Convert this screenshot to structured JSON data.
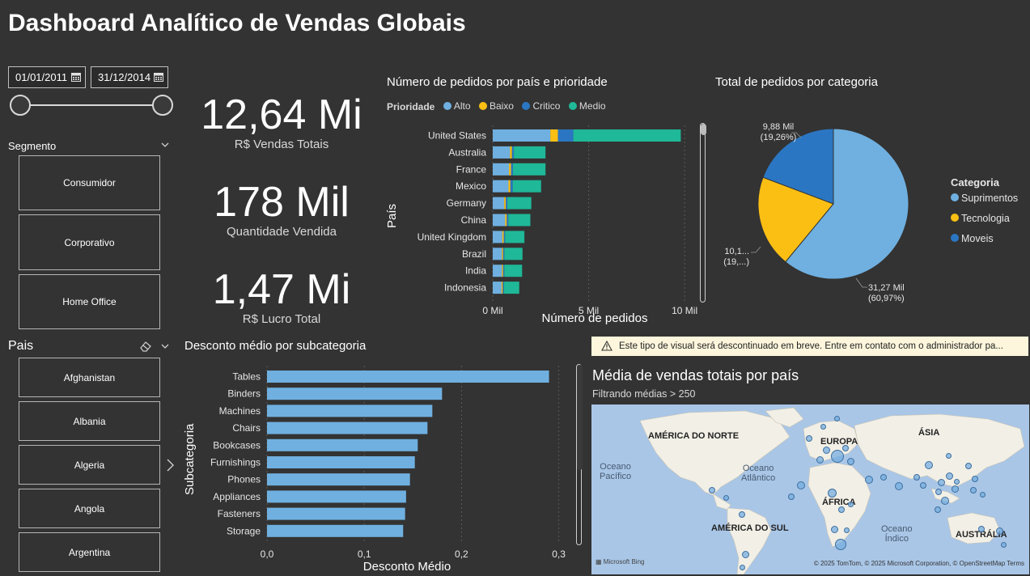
{
  "title": "Dashboard Analítico de Vendas Globais",
  "filters": {
    "date_start": "01/01/2011",
    "date_end": "31/12/2014",
    "segment_label": "Segmento",
    "segments": [
      "Consumidor",
      "Corporativo",
      "Home Office"
    ],
    "country_label": "Pais",
    "countries": [
      "Afghanistan",
      "Albania",
      "Algeria",
      "Angola",
      "Argentina"
    ]
  },
  "kpis": [
    {
      "value": "12,64 Mi",
      "label": "R$ Vendas Totais"
    },
    {
      "value": "178 Mil",
      "label": "Quantidade Vendida"
    },
    {
      "value": "1,47 Mi",
      "label": "R$ Lucro Total"
    }
  ],
  "colors": {
    "alto": "#6fb0e0",
    "baixo": "#fbbf14",
    "critico": "#2b76c2",
    "medio": "#1fb898",
    "bar": "#6fb0e0",
    "background": "#333333"
  },
  "orders_chart": {
    "title": "Número de pedidos por país e prioridade",
    "legend_title": "Prioridade",
    "legend": [
      "Alto",
      "Baixo",
      "Critico",
      "Medio"
    ],
    "ylabel": "País",
    "xlabel": "Número de pedidos",
    "xticks": [
      "0 Mil",
      "5 Mil",
      "10 Mil"
    ]
  },
  "category_chart": {
    "title": "Total de pedidos por categoria",
    "legend_title": "Categoria",
    "legend": [
      "Suprimentos",
      "Tecnologia",
      "Moveis"
    ],
    "labels": [
      {
        "line1": "31,27 Mil",
        "line2": "(60,97%)"
      },
      {
        "line1": "10,1...",
        "line2": "(19,...)"
      },
      {
        "line1": "9,88 Mil",
        "line2": "(19,26%)"
      }
    ]
  },
  "discount_chart": {
    "title": "Desconto médio por subcategoria",
    "ylabel": "Subcategoria",
    "xlabel": "Desconto Médio",
    "xticks": [
      "0,0",
      "0,1",
      "0,2",
      "0,3"
    ]
  },
  "map_visual": {
    "warning": "Este tipo de visual será descontinuado em breve. Entre em contato com o administrador pa...",
    "title": "Média de vendas totais por país",
    "subtitle": "Filtrando médias > 250",
    "labels": {
      "north_america": "AMÉRICA DO NORTE",
      "europe": "EUROPA",
      "asia": "ÁSIA",
      "africa": "ÁFRICA",
      "south_america": "AMÉRICA DO SUL",
      "australia": "AUSTRÁLIA",
      "pacific_1": "Oceano",
      "pacific_2": "Pacífico",
      "atlantic_1": "Oceano",
      "atlantic_2": "Atlântico",
      "indian_1": "Oceano",
      "indian_2": "Índico"
    },
    "credit": "Microsoft Bing",
    "copyright": "© 2025 TomTom, © 2025 Microsoft Corporation, © OpenStreetMap  Terms"
  },
  "chart_data": [
    {
      "type": "bar",
      "orientation": "horizontal",
      "stacked": true,
      "title": "Número de pedidos por país e prioridade",
      "xlabel": "Número de pedidos",
      "ylabel": "País",
      "xlim": [
        0,
        10500
      ],
      "categories": [
        "United States",
        "Australia",
        "France",
        "Mexico",
        "Germany",
        "China",
        "United Kingdom",
        "Brazil",
        "India",
        "Indonesia"
      ],
      "series": [
        {
          "name": "Alto",
          "values": [
            3000,
            900,
            850,
            820,
            600,
            650,
            500,
            480,
            480,
            460
          ]
        },
        {
          "name": "Baixo",
          "values": [
            400,
            100,
            100,
            100,
            80,
            80,
            70,
            60,
            60,
            60
          ]
        },
        {
          "name": "Critico",
          "values": [
            800,
            100,
            100,
            120,
            80,
            80,
            70,
            60,
            60,
            60
          ]
        },
        {
          "name": "Medio",
          "values": [
            5600,
            1650,
            1700,
            1480,
            1250,
            1150,
            1010,
            950,
            930,
            800
          ]
        }
      ]
    },
    {
      "type": "pie",
      "title": "Total de pedidos por categoria",
      "categories": [
        "Suprimentos",
        "Tecnologia",
        "Moveis"
      ],
      "values": [
        31270,
        10130,
        9880
      ],
      "percentages": [
        60.97,
        19.77,
        19.26
      ]
    },
    {
      "type": "bar",
      "orientation": "horizontal",
      "title": "Desconto médio por subcategoria",
      "xlabel": "Desconto Médio",
      "ylabel": "Subcategoria",
      "xlim": [
        0,
        0.3
      ],
      "categories": [
        "Tables",
        "Binders",
        "Machines",
        "Chairs",
        "Bookcases",
        "Furnishings",
        "Phones",
        "Appliances",
        "Fasteners",
        "Storage"
      ],
      "values": [
        0.29,
        0.18,
        0.17,
        0.165,
        0.155,
        0.152,
        0.147,
        0.143,
        0.142,
        0.14
      ]
    }
  ]
}
